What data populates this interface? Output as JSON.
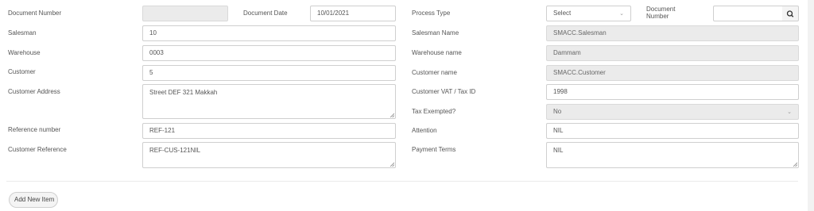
{
  "form": {
    "document_number_label": "Document Number",
    "document_number_value": "",
    "document_date_label": "Document Date",
    "document_date_value": "10/01/2021",
    "process_type_label": "Process Type",
    "process_type_value": "Select",
    "document_number2_label_line1": "Document",
    "document_number2_label_line2": "Number",
    "document_number2_value": "",
    "salesman_label": "Salesman",
    "salesman_value": "10",
    "salesman_name_label": "Salesman Name",
    "salesman_name_value": "SMACC.Salesman",
    "warehouse_label": "Warehouse",
    "warehouse_value": "0003",
    "warehouse_name_label": "Warehouse name",
    "warehouse_name_value": "Dammam",
    "customer_label": "Customer",
    "customer_value": "5",
    "customer_name_label": "Customer name",
    "customer_name_value": "SMACC.Customer",
    "customer_address_label": "Customer Address",
    "customer_address_value": "Street DEF 321 Makkah",
    "customer_vat_label": "Customer VAT / Tax ID",
    "customer_vat_value": "1998",
    "tax_exempted_label": "Tax Exempted?",
    "tax_exempted_value": "No",
    "reference_number_label": "Reference number",
    "reference_number_value": "REF-121",
    "attention_label": "Attention",
    "attention_value": "NIL",
    "customer_reference_label": "Customer Reference",
    "customer_reference_value": "REF-CUS-121NIL",
    "payment_terms_label": "Payment Terms",
    "payment_terms_value": "NIL"
  },
  "actions": {
    "add_new_item_label": "Add New Item"
  },
  "icons": {
    "search": "search-icon",
    "chevron": "chevron-down-icon",
    "resize": "resize-grip-icon"
  }
}
